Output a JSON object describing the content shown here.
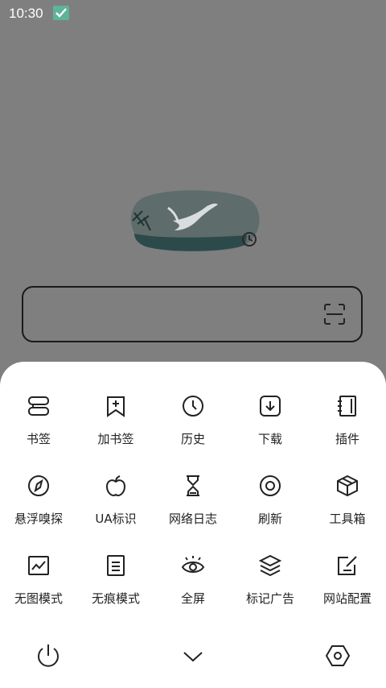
{
  "status_bar": {
    "time": "10:30"
  },
  "menu": {
    "items": [
      {
        "label": "书签",
        "icon": "bookmark-icon"
      },
      {
        "label": "加书签",
        "icon": "add-bookmark-icon"
      },
      {
        "label": "历史",
        "icon": "clock-icon"
      },
      {
        "label": "下载",
        "icon": "download-icon"
      },
      {
        "label": "插件",
        "icon": "plugin-icon"
      },
      {
        "label": "悬浮嗅探",
        "icon": "compass-icon"
      },
      {
        "label": "UA标识",
        "icon": "apple-icon"
      },
      {
        "label": "网络日志",
        "icon": "hourglass-icon"
      },
      {
        "label": "刷新",
        "icon": "refresh-icon"
      },
      {
        "label": "工具箱",
        "icon": "box-icon"
      },
      {
        "label": "无图模式",
        "icon": "image-icon"
      },
      {
        "label": "无痕模式",
        "icon": "document-icon"
      },
      {
        "label": "全屏",
        "icon": "eye-icon"
      },
      {
        "label": "标记广告",
        "icon": "layers-icon"
      },
      {
        "label": "网站配置",
        "icon": "edit-icon"
      }
    ]
  },
  "bottom_bar": {
    "power": "power-icon",
    "collapse": "chevron-down-icon",
    "settings": "hexagon-settings-icon"
  }
}
